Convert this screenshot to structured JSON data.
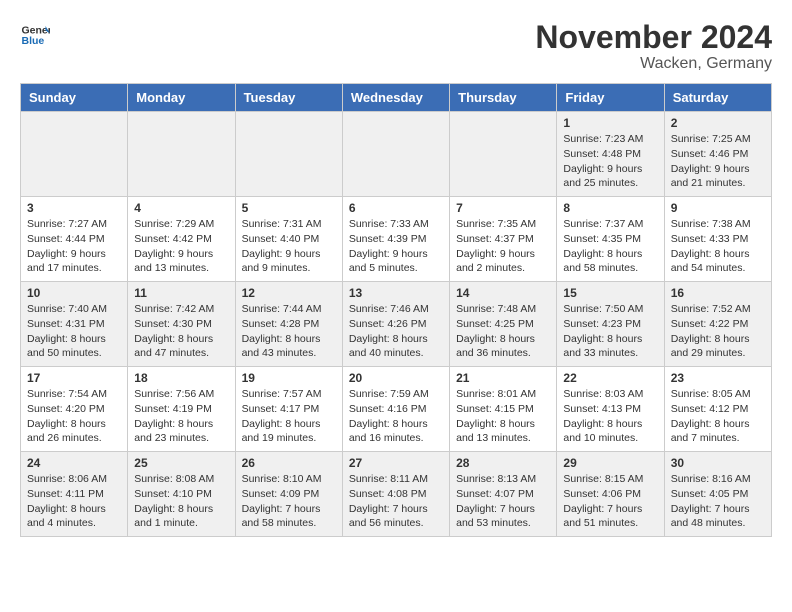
{
  "logo": {
    "text_general": "General",
    "text_blue": "Blue"
  },
  "header": {
    "month": "November 2024",
    "location": "Wacken, Germany"
  },
  "days_of_week": [
    "Sunday",
    "Monday",
    "Tuesday",
    "Wednesday",
    "Thursday",
    "Friday",
    "Saturday"
  ],
  "weeks": [
    [
      {
        "day": null,
        "info": ""
      },
      {
        "day": null,
        "info": ""
      },
      {
        "day": null,
        "info": ""
      },
      {
        "day": null,
        "info": ""
      },
      {
        "day": null,
        "info": ""
      },
      {
        "day": "1",
        "info": "Sunrise: 7:23 AM\nSunset: 4:48 PM\nDaylight: 9 hours\nand 25 minutes."
      },
      {
        "day": "2",
        "info": "Sunrise: 7:25 AM\nSunset: 4:46 PM\nDaylight: 9 hours\nand 21 minutes."
      }
    ],
    [
      {
        "day": "3",
        "info": "Sunrise: 7:27 AM\nSunset: 4:44 PM\nDaylight: 9 hours\nand 17 minutes."
      },
      {
        "day": "4",
        "info": "Sunrise: 7:29 AM\nSunset: 4:42 PM\nDaylight: 9 hours\nand 13 minutes."
      },
      {
        "day": "5",
        "info": "Sunrise: 7:31 AM\nSunset: 4:40 PM\nDaylight: 9 hours\nand 9 minutes."
      },
      {
        "day": "6",
        "info": "Sunrise: 7:33 AM\nSunset: 4:39 PM\nDaylight: 9 hours\nand 5 minutes."
      },
      {
        "day": "7",
        "info": "Sunrise: 7:35 AM\nSunset: 4:37 PM\nDaylight: 9 hours\nand 2 minutes."
      },
      {
        "day": "8",
        "info": "Sunrise: 7:37 AM\nSunset: 4:35 PM\nDaylight: 8 hours\nand 58 minutes."
      },
      {
        "day": "9",
        "info": "Sunrise: 7:38 AM\nSunset: 4:33 PM\nDaylight: 8 hours\nand 54 minutes."
      }
    ],
    [
      {
        "day": "10",
        "info": "Sunrise: 7:40 AM\nSunset: 4:31 PM\nDaylight: 8 hours\nand 50 minutes."
      },
      {
        "day": "11",
        "info": "Sunrise: 7:42 AM\nSunset: 4:30 PM\nDaylight: 8 hours\nand 47 minutes."
      },
      {
        "day": "12",
        "info": "Sunrise: 7:44 AM\nSunset: 4:28 PM\nDaylight: 8 hours\nand 43 minutes."
      },
      {
        "day": "13",
        "info": "Sunrise: 7:46 AM\nSunset: 4:26 PM\nDaylight: 8 hours\nand 40 minutes."
      },
      {
        "day": "14",
        "info": "Sunrise: 7:48 AM\nSunset: 4:25 PM\nDaylight: 8 hours\nand 36 minutes."
      },
      {
        "day": "15",
        "info": "Sunrise: 7:50 AM\nSunset: 4:23 PM\nDaylight: 8 hours\nand 33 minutes."
      },
      {
        "day": "16",
        "info": "Sunrise: 7:52 AM\nSunset: 4:22 PM\nDaylight: 8 hours\nand 29 minutes."
      }
    ],
    [
      {
        "day": "17",
        "info": "Sunrise: 7:54 AM\nSunset: 4:20 PM\nDaylight: 8 hours\nand 26 minutes."
      },
      {
        "day": "18",
        "info": "Sunrise: 7:56 AM\nSunset: 4:19 PM\nDaylight: 8 hours\nand 23 minutes."
      },
      {
        "day": "19",
        "info": "Sunrise: 7:57 AM\nSunset: 4:17 PM\nDaylight: 8 hours\nand 19 minutes."
      },
      {
        "day": "20",
        "info": "Sunrise: 7:59 AM\nSunset: 4:16 PM\nDaylight: 8 hours\nand 16 minutes."
      },
      {
        "day": "21",
        "info": "Sunrise: 8:01 AM\nSunset: 4:15 PM\nDaylight: 8 hours\nand 13 minutes."
      },
      {
        "day": "22",
        "info": "Sunrise: 8:03 AM\nSunset: 4:13 PM\nDaylight: 8 hours\nand 10 minutes."
      },
      {
        "day": "23",
        "info": "Sunrise: 8:05 AM\nSunset: 4:12 PM\nDaylight: 8 hours\nand 7 minutes."
      }
    ],
    [
      {
        "day": "24",
        "info": "Sunrise: 8:06 AM\nSunset: 4:11 PM\nDaylight: 8 hours\nand 4 minutes."
      },
      {
        "day": "25",
        "info": "Sunrise: 8:08 AM\nSunset: 4:10 PM\nDaylight: 8 hours\nand 1 minute."
      },
      {
        "day": "26",
        "info": "Sunrise: 8:10 AM\nSunset: 4:09 PM\nDaylight: 7 hours\nand 58 minutes."
      },
      {
        "day": "27",
        "info": "Sunrise: 8:11 AM\nSunset: 4:08 PM\nDaylight: 7 hours\nand 56 minutes."
      },
      {
        "day": "28",
        "info": "Sunrise: 8:13 AM\nSunset: 4:07 PM\nDaylight: 7 hours\nand 53 minutes."
      },
      {
        "day": "29",
        "info": "Sunrise: 8:15 AM\nSunset: 4:06 PM\nDaylight: 7 hours\nand 51 minutes."
      },
      {
        "day": "30",
        "info": "Sunrise: 8:16 AM\nSunset: 4:05 PM\nDaylight: 7 hours\nand 48 minutes."
      }
    ]
  ]
}
